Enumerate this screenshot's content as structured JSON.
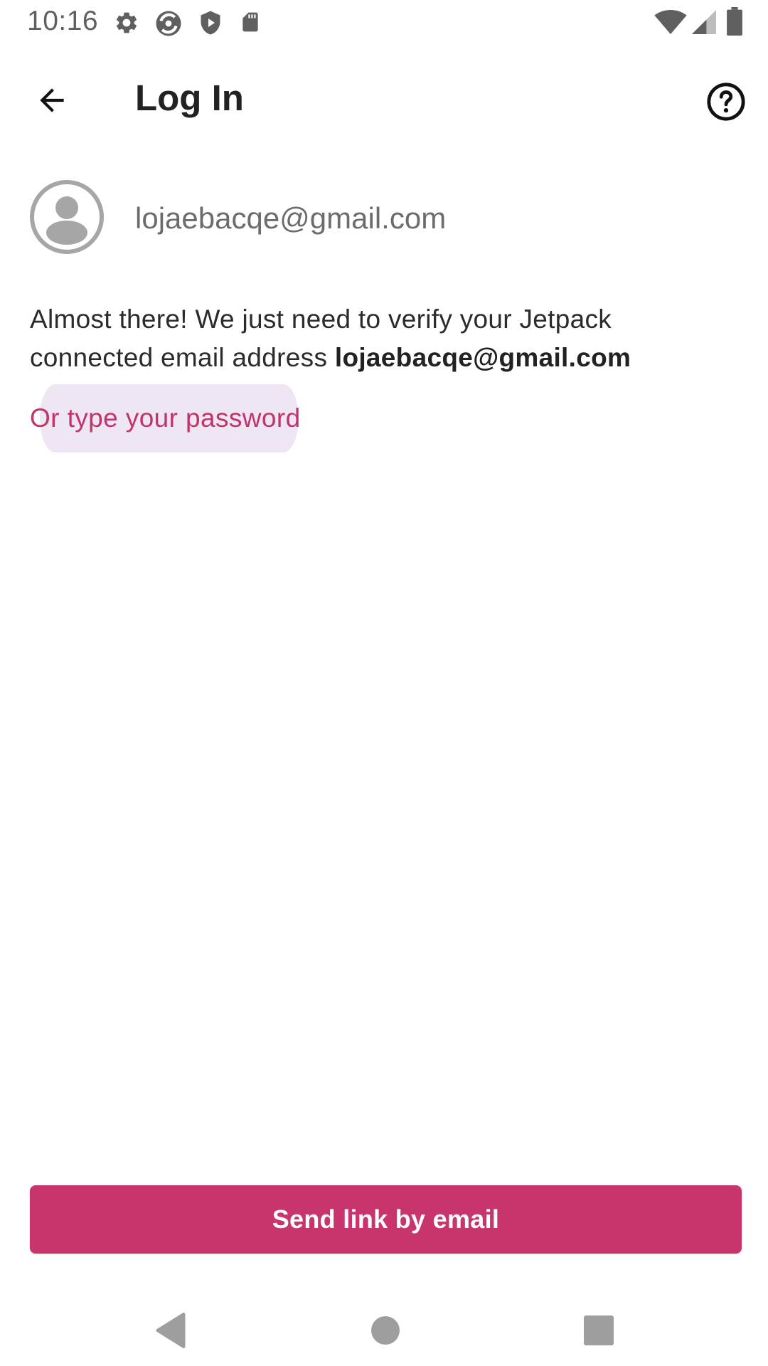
{
  "status_bar": {
    "time": "10:16",
    "left_icons": [
      "settings-icon",
      "sync-icon",
      "shield-play-icon",
      "sd-card-icon"
    ],
    "right_icons": [
      "wifi-icon",
      "cellular-signal-icon",
      "battery-icon"
    ]
  },
  "app_bar": {
    "title": "Log In",
    "back_icon": "arrow-back-icon",
    "help_icon": "help-circle-icon"
  },
  "account": {
    "email": "lojaebacqe@gmail.com",
    "avatar_icon": "account-circle-icon"
  },
  "message": {
    "text": "Almost there! We just need to verify your Jetpack connected email address",
    "email_bold": "lojaebacqe@gmail.com"
  },
  "password_link": {
    "label": "Or type your password"
  },
  "primary_button": {
    "label": "Send link by email"
  },
  "nav_bar": {
    "icons": [
      "nav-back-icon",
      "nav-home-icon",
      "nav-recents-icon"
    ]
  },
  "colors": {
    "accent": "#c8346c",
    "link": "#c2336b",
    "ripple": "#eee6f3",
    "text_primary": "#222222",
    "text_secondary": "#6c6c6c"
  }
}
